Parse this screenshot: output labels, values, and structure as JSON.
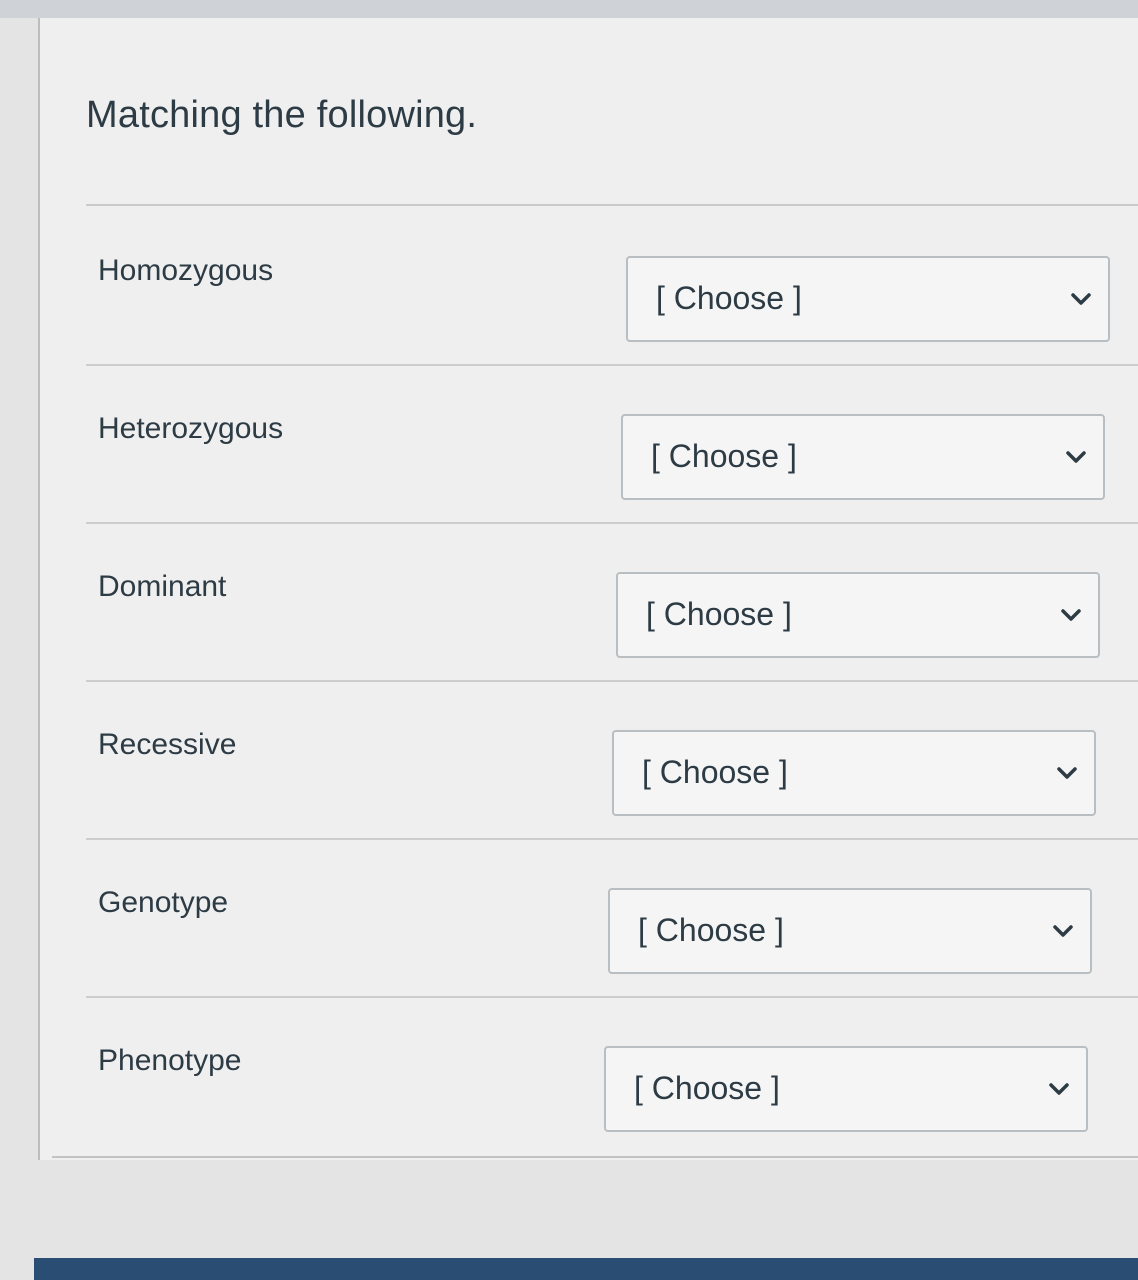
{
  "question": {
    "title": "Matching the following."
  },
  "rows": [
    {
      "term": "Homozygous",
      "selected": "[ Choose ]"
    },
    {
      "term": "Heterozygous",
      "selected": "[ Choose ]"
    },
    {
      "term": "Dominant",
      "selected": "[ Choose ]"
    },
    {
      "term": "Recessive",
      "selected": "[ Choose ]"
    },
    {
      "term": "Genotype",
      "selected": "[ Choose ]"
    },
    {
      "term": "Phenotype",
      "selected": "[ Choose ]"
    }
  ],
  "icons": {
    "dropdown": "chevron-down-icon"
  },
  "colors": {
    "text": "#2d3b45",
    "select_border": "#b9bec2",
    "page_background": "#efefef"
  }
}
